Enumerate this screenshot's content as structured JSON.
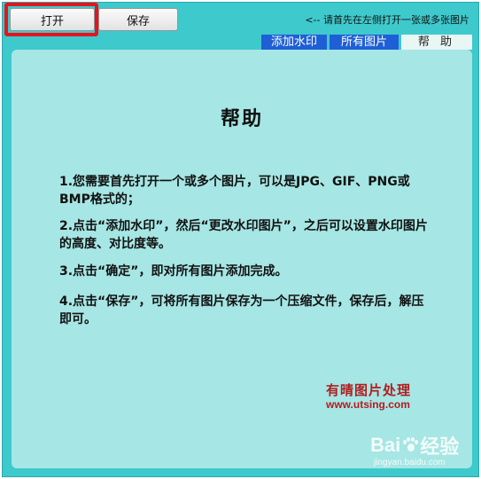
{
  "toolbar": {
    "open_label": "打开",
    "save_label": "保存",
    "hint": "<-- 请首先在左侧打开一张或多张图片"
  },
  "tabs": [
    {
      "label": "添加水印",
      "active": false
    },
    {
      "label": "所有图片",
      "active": false
    },
    {
      "label": "帮 助",
      "active": true
    }
  ],
  "help": {
    "title": "帮助",
    "paragraphs": [
      "1.您需要首先打开一个或多个图片，可以是JPG、GIF、PNG或BMP格式的；",
      "2.点击“添加水印”，然后“更改水印图片”，之后可以设置水印图片的高度、对比度等。",
      "3.点击“确定”，即对所有图片添加完成。",
      "4.点击“保存”，可将所有图片保存为一个压缩文件，保存后，解压即可。"
    ],
    "brand_name": "有晴图片处理",
    "brand_url": "www.utsing.com"
  },
  "watermark": {
    "logo_text_1": "Bai",
    "logo_text_2": "经验",
    "url": "jingyan.baidu.com"
  },
  "colors": {
    "window_bg": "#3ec9cc",
    "panel_bg": "#a6e6e4",
    "tab_active_bg": "#1f5fd6",
    "highlight": "#e8131c",
    "brand": "#b01e1e"
  }
}
